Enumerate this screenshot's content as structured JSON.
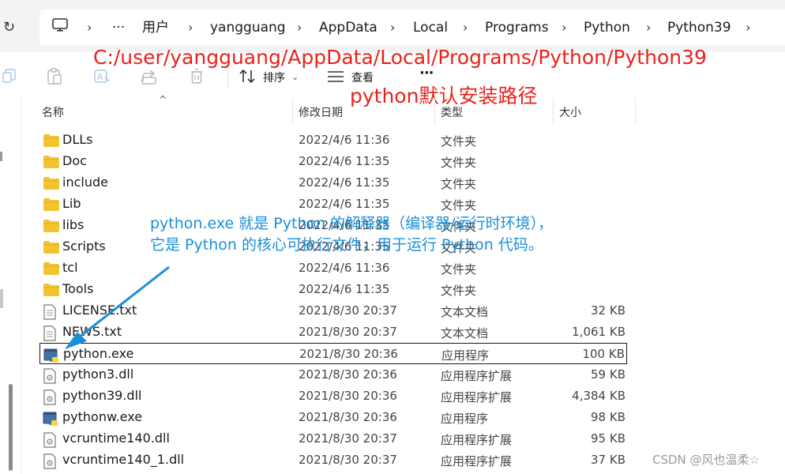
{
  "breadcrumb": {
    "more": "···",
    "items": [
      "用户",
      "yangguang",
      "AppData",
      "Local",
      "Programs",
      "Python",
      "Python39"
    ]
  },
  "toolbar": {
    "sort_label": "排序",
    "view_label": "查看",
    "more_label": "···"
  },
  "annotations": {
    "path": "C:/user/yangguang/AppData/Local/Programs/Python/Python39",
    "path_caption": "python默认安装路径",
    "note_line1": "python.exe 就是 Python 的解释器（编译器/运行时环境），",
    "note_line2": "它是 Python 的核心可执行文件，用于运行 Python 代码。"
  },
  "columns": {
    "name": "名称",
    "modified": "修改日期",
    "type": "类型",
    "size": "大小"
  },
  "files": [
    {
      "name": "DLLs",
      "date": "2022/4/6 11:36",
      "type": "文件夹",
      "size": "",
      "icon": "folder-icon"
    },
    {
      "name": "Doc",
      "date": "2022/4/6 11:35",
      "type": "文件夹",
      "size": "",
      "icon": "folder-icon"
    },
    {
      "name": "include",
      "date": "2022/4/6 11:35",
      "type": "文件夹",
      "size": "",
      "icon": "folder-icon"
    },
    {
      "name": "Lib",
      "date": "2022/4/6 11:35",
      "type": "文件夹",
      "size": "",
      "icon": "folder-icon"
    },
    {
      "name": "libs",
      "date": "2022/4/6 11:35",
      "type": "文件夹",
      "size": "",
      "icon": "folder-icon"
    },
    {
      "name": "Scripts",
      "date": "2022/4/6 11:35",
      "type": "文件夹",
      "size": "",
      "icon": "folder-icon"
    },
    {
      "name": "tcl",
      "date": "2022/4/6 11:36",
      "type": "文件夹",
      "size": "",
      "icon": "folder-icon"
    },
    {
      "name": "Tools",
      "date": "2022/4/6 11:35",
      "type": "文件夹",
      "size": "",
      "icon": "folder-icon"
    },
    {
      "name": "LICENSE.txt",
      "date": "2021/8/30 20:37",
      "type": "文本文档",
      "size": "32 KB",
      "icon": "text-file-icon"
    },
    {
      "name": "NEWS.txt",
      "date": "2021/8/30 20:37",
      "type": "文本文档",
      "size": "1,061 KB",
      "icon": "text-file-icon"
    },
    {
      "name": "python.exe",
      "date": "2021/8/30 20:36",
      "type": "应用程序",
      "size": "100 KB",
      "icon": "python-exe-icon"
    },
    {
      "name": "python3.dll",
      "date": "2021/8/30 20:36",
      "type": "应用程序扩展",
      "size": "59 KB",
      "icon": "dll-file-icon"
    },
    {
      "name": "python39.dll",
      "date": "2021/8/30 20:36",
      "type": "应用程序扩展",
      "size": "4,384 KB",
      "icon": "dll-file-icon"
    },
    {
      "name": "pythonw.exe",
      "date": "2021/8/30 20:36",
      "type": "应用程序",
      "size": "98 KB",
      "icon": "python-exe-icon"
    },
    {
      "name": "vcruntime140.dll",
      "date": "2021/8/30 20:37",
      "type": "应用程序扩展",
      "size": "95 KB",
      "icon": "dll-file-icon"
    },
    {
      "name": "vcruntime140_1.dll",
      "date": "2021/8/30 20:37",
      "type": "应用程序扩展",
      "size": "37 KB",
      "icon": "dll-file-icon"
    }
  ],
  "watermark": "CSDN @风也温柔☆",
  "colors": {
    "annotation_red": "#e8231c",
    "annotation_blue": "#1a8fd8",
    "folder": "#f4c430"
  }
}
